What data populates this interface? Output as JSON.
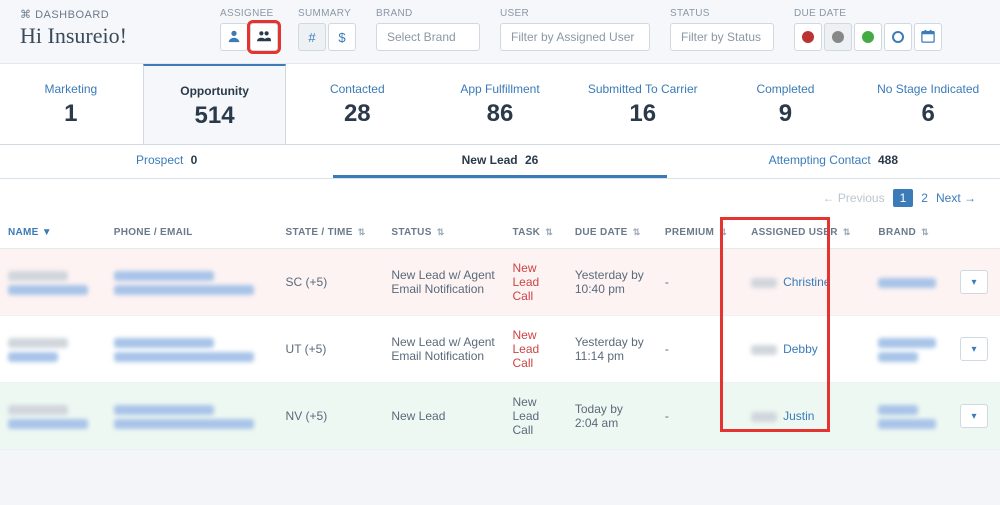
{
  "header": {
    "dash_label": "DASHBOARD",
    "greeting": "Hi Insureio!",
    "filters": {
      "assignee": {
        "label": "ASSIGNEE"
      },
      "summary": {
        "label": "SUMMARY"
      },
      "brand": {
        "label": "BRAND",
        "placeholder": "Select Brand"
      },
      "user": {
        "label": "USER",
        "placeholder": "Filter by Assigned User"
      },
      "status": {
        "label": "STATUS",
        "placeholder": "Filter by Status"
      },
      "due": {
        "label": "DUE DATE"
      }
    }
  },
  "stages": [
    {
      "label": "Marketing",
      "count": "1"
    },
    {
      "label": "Opportunity",
      "count": "514",
      "active": true
    },
    {
      "label": "Contacted",
      "count": "28"
    },
    {
      "label": "App Fulfillment",
      "count": "86"
    },
    {
      "label": "Submitted To Carrier",
      "count": "16"
    },
    {
      "label": "Completed",
      "count": "9"
    },
    {
      "label": "No Stage Indicated",
      "count": "6"
    }
  ],
  "substages": [
    {
      "label": "Prospect",
      "count": "0"
    },
    {
      "label": "New Lead",
      "count": "26",
      "active": true
    },
    {
      "label": "Attempting Contact",
      "count": "488"
    }
  ],
  "pagination": {
    "prev": "← Previous",
    "pages": [
      "1",
      "2"
    ],
    "current": "1",
    "next": "Next →"
  },
  "columns": {
    "name": "NAME",
    "phone": "PHONE / EMAIL",
    "state": "STATE / TIME",
    "status": "STATUS",
    "task": "TASK",
    "due": "DUE DATE",
    "premium": "PREMIUM",
    "assigned": "ASSIGNED USER",
    "brand": "BRAND"
  },
  "rows": [
    {
      "state": "SC (+5)",
      "status": "New Lead w/ Agent Email Notification",
      "task": "New Lead Call",
      "due": "Yesterday by 10:40 pm",
      "premium": "-",
      "assigned": "Christine"
    },
    {
      "state": "UT (+5)",
      "status": "New Lead w/ Agent Email Notification",
      "task": "New Lead Call",
      "due": "Yesterday by 11:14 pm",
      "premium": "-",
      "assigned": "Debby"
    },
    {
      "state": "NV (+5)",
      "status": "New Lead",
      "task": "New Lead Call",
      "due": "Today by 2:04 am",
      "premium": "-",
      "assigned": "Justin"
    }
  ]
}
